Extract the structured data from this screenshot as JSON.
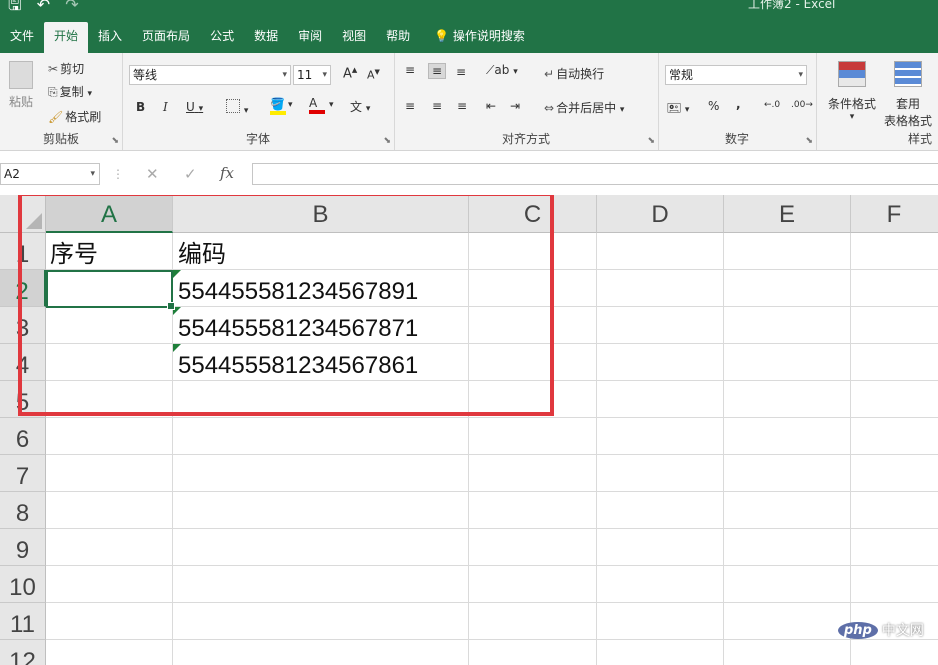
{
  "app": {
    "window_title": "工作簿2 - Excel"
  },
  "tabs": [
    "文件",
    "开始",
    "插入",
    "页面布局",
    "公式",
    "数据",
    "审阅",
    "视图",
    "帮助"
  ],
  "tell_me": "操作说明搜索",
  "ribbon": {
    "clipboard": {
      "paste": "粘贴",
      "cut": "剪切",
      "copy": "复制",
      "format_painter": "格式刷",
      "label": "剪贴板"
    },
    "font": {
      "name": "等线",
      "size": "11",
      "label": "字体",
      "bold": "B",
      "italic": "I",
      "underline": "U",
      "grow": "A",
      "shrink": "A",
      "color_letter": "A",
      "phonetic": "文",
      "fill_color": "#ffeb00",
      "font_color": "#e00000"
    },
    "alignment": {
      "wrap": "自动换行",
      "merge": "合并后居中",
      "label": "对齐方式"
    },
    "number": {
      "format": "常规",
      "label": "数字",
      "percent": "%",
      "comma": ","
    },
    "styles": {
      "conditional": "条件格式",
      "table_line1": "套用",
      "table_line2": "表格格式",
      "label": "样式"
    }
  },
  "formula_bar": {
    "name_box": "A2",
    "fx": "fx",
    "formula": ""
  },
  "columns": [
    "A",
    "B",
    "C",
    "D",
    "E",
    "F"
  ],
  "rows": [
    "1",
    "2",
    "3",
    "4",
    "5",
    "6",
    "7",
    "8",
    "9",
    "10",
    "11",
    "12"
  ],
  "cells": {
    "A1": "序号",
    "B1": "编码",
    "B2": "5544555812345678​91",
    "B3": "554455581234567871",
    "B4": "554455581234567861"
  },
  "watermark": {
    "logo": "php",
    "text": "中文网"
  },
  "colors": {
    "brand": "#217346",
    "highlight_box": "#e0383e"
  }
}
